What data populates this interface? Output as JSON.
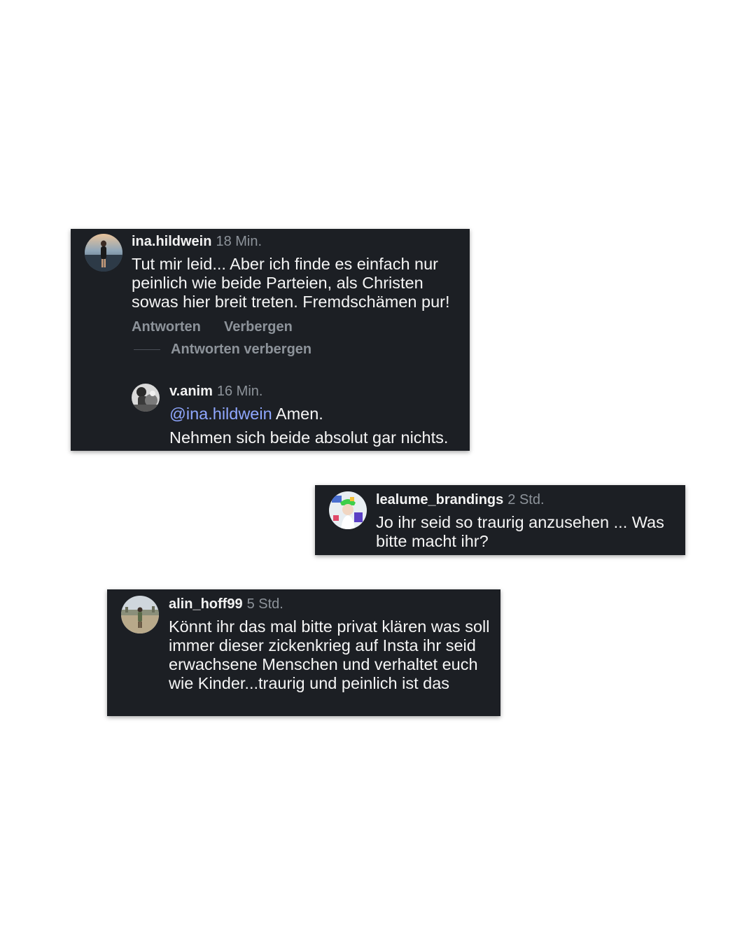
{
  "comments": [
    {
      "username": "ina.hildwein",
      "time": "18 Min.",
      "text": "Tut mir leid... Aber ich finde es einfach nur peinlich wie beide Parteien, als Christen sowas hier breit treten. Fremdschämen pur!",
      "actions": {
        "reply": "Antworten",
        "hide": "Verbergen",
        "hide_replies": "Antworten verbergen"
      },
      "reply": {
        "username": "v.anim",
        "time": "16 Min.",
        "mention": "@ina.hildwein",
        "text_after_mention": " Amen.",
        "text_line2": "Nehmen sich beide absolut gar nichts."
      }
    },
    {
      "username": "lealume_brandings",
      "time": "2 Std.",
      "text": "Jo ihr seid so traurig anzusehen ... Was bitte macht ihr?"
    },
    {
      "username": "alin_hoff99",
      "time": "5 Std.",
      "text": "Könnt ihr das mal bitte privat klären was soll immer dieser zickenkrieg auf Insta ihr seid erwachsene Menschen und verhaltet euch wie Kinder...traurig und peinlich ist das"
    }
  ],
  "colors": {
    "card_bg": "#1c1f24",
    "username": "#f2f2f2",
    "muted": "#8d939a",
    "mention": "#8fa7ff",
    "page_bg": "#ffffff"
  }
}
